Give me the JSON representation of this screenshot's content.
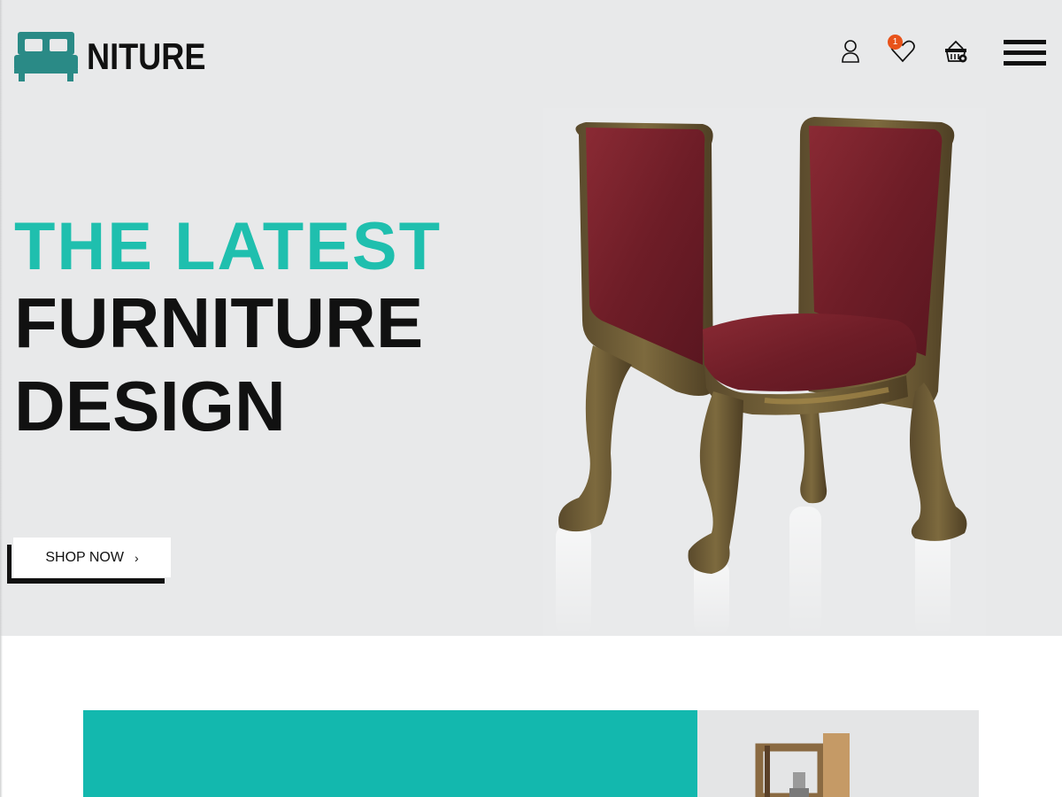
{
  "brand": {
    "logo_text": "NITURE",
    "logo_icon": "bed-icon",
    "colors": {
      "accent": "#1fbfae",
      "dark": "#111111",
      "badge": "#e8531a",
      "promo": "#13b8ae",
      "hero_bg": "#e8e9ea"
    }
  },
  "header": {
    "icons": [
      "user-icon",
      "heart-icon",
      "basket-icon",
      "hamburger-menu-icon"
    ],
    "wishlist_count": "1"
  },
  "hero": {
    "line1": "THE LATEST",
    "line2": "FURNITURE",
    "line3": "DESIGN",
    "cta_label": "SHOP NOW",
    "cta_arrow": "›",
    "image": "upholstered-chair"
  },
  "promo": {
    "image": "wall-shelf"
  }
}
